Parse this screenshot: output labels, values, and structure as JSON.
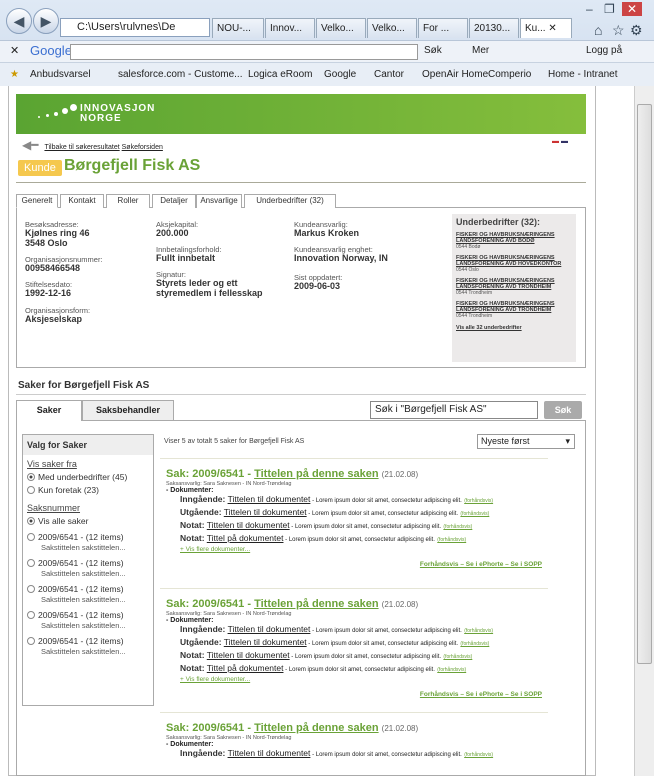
{
  "browser": {
    "url": "C:\\Users\\rulvnes\\De",
    "tabs": [
      "NOU-...",
      "Innov...",
      "Velko...",
      "Velko...",
      "For ...",
      "20130...",
      "Ku..."
    ],
    "google_label": "Google",
    "search_label": "Søk",
    "more_label": "Mer",
    "login_label": "Logg på",
    "favorites": [
      "Anbudsvarsel",
      "salesforce.com - Custome...",
      "Logica eRoom",
      "Google",
      "Cantor",
      "OpenAir Home",
      "Comperio",
      "Home - Intranet"
    ]
  },
  "site": {
    "brand_line1": "INNOVASJON",
    "brand_line2": "NORGE",
    "back_link": "Tilbake til søkeresultatet",
    "front_link": "Søkeforsiden"
  },
  "customer": {
    "badge": "Kunde",
    "name": "Børgefjell Fisk AS"
  },
  "tabs": [
    "Generelt",
    "Kontakt",
    "Roller",
    "Detaljer",
    "Ansvarlige",
    "Underbedrifter (32)"
  ],
  "info": {
    "col1": [
      {
        "label": "Besøksadresse:",
        "value": "Kjølnes ring 46\n3548 Oslo"
      },
      {
        "label": "Organisasjonsnummer:",
        "value": "00958466548"
      },
      {
        "label": "Stiftelsesdato:",
        "value": "1992-12-16"
      },
      {
        "label": "Organisasjonsform:",
        "value": "Aksjeselskap"
      }
    ],
    "col2": [
      {
        "label": "Aksjekapital:",
        "value": "200.000"
      },
      {
        "label": "Innbetalingsforhold:",
        "value": "Fullt innbetalt"
      },
      {
        "label": "Signatur:",
        "value": "Styrets leder og ett styremedlem i fellesskap"
      }
    ],
    "col3": [
      {
        "label": "Kundeansvarlig:",
        "value": "Markus Kroken"
      },
      {
        "label": "Kundeansvarlig enghet:",
        "value": "Innovation Norway, IN"
      },
      {
        "label": "Sist oppdatert:",
        "value": "2009-06-03"
      }
    ]
  },
  "subsidiaries": {
    "title": "Underbedrifter (32):",
    "items": [
      {
        "name": "FISKERI OG HAVBRUKSNÆRINGENS LANDSFORENING AVD BODØ",
        "place": "0544 Bodø"
      },
      {
        "name": "FISKERI OG HAVBRUKSNÆRINGENS LANDSFORENING AVD HOVEDKONTOR",
        "place": "0544 Oslo"
      },
      {
        "name": "FISKERI OG HAVBRUKSNÆRINGENS LANDSFORENING AVD TRONDHEIM",
        "place": "0544 Trondheim"
      },
      {
        "name": "FISKERI OG HAVBRUKSNÆRINGENS LANDSFORENING AVD TRONDHEIM",
        "place": "0544 Trondheim"
      }
    ],
    "all_link": "Vis alle 32 underbedrifter"
  },
  "cases": {
    "heading": "Saker for Børgefjell Fisk AS",
    "tab_saker": "Saker",
    "tab_saksbehandler": "Saksbehandler",
    "search_value": "Søk i \"Børgefjell Fisk AS\"",
    "search_btn": "Søk",
    "filter_title": "Valg for Saker",
    "show_from": "Vis saker fra",
    "opt_with": "Med underbedrifter (45)",
    "opt_only": "Kun foretak (23)",
    "casenr": "Saksnummer",
    "show_all": "Vis alle saker",
    "count_text": "Viser 5 av totalt 5 saker for Børgefjell Fisk AS",
    "sort": "Nyeste først",
    "filter_items": [
      {
        "nr": "2009/6541 - (12 items)",
        "sub": "Sakstittelen sakstittelen..."
      },
      {
        "nr": "2009/6541 - (12 items)",
        "sub": "Sakstittelen sakstittelen..."
      },
      {
        "nr": "2009/6541 - (12 items)",
        "sub": "Sakstittelen sakstittelen..."
      },
      {
        "nr": "2009/6541 - (12 items)",
        "sub": "Sakstittelen sakstittelen..."
      },
      {
        "nr": "2009/6541 - (12 items)",
        "sub": "Sakstittelen sakstittelen..."
      }
    ]
  },
  "case_items": [
    {
      "prefix": "Sak: 2009/6541 - ",
      "title": "Tittelen på denne saken",
      "date": "(21.02.08)",
      "meta": "Saksansvarlig: Sara Saknesen - IN Nord-Trøndelag",
      "docs_label": "- Dokumenter:",
      "docs": [
        {
          "type": "Inngående:",
          "title": "Tittelen til dokumentet"
        },
        {
          "type": "Utgående:",
          "title": "Tittelen til dokumentet"
        },
        {
          "type": "Notat:",
          "title": "Tittelen til dokumentet"
        },
        {
          "type": "Notat:",
          "title": "Tittel på dokumentet"
        }
      ],
      "lorem": " - Lorem ipsum dolor sit amet, consectetur adipiscing elit.",
      "preview": "(forhåndsvis)",
      "more": "+ Vis flere dokumenter...",
      "foot": "Forhåndsvis – Se i ePhorte – Se i SOPP"
    },
    {
      "prefix": "Sak: 2009/6541 - ",
      "title": "Tittelen på denne saken",
      "date": "(21.02.08)",
      "meta": "Saksansvarlig: Sara Saknesen - IN Nord-Trøndelag",
      "docs_label": "- Dokumenter:",
      "docs": [
        {
          "type": "Inngående:",
          "title": "Tittelen til dokumentet"
        },
        {
          "type": "Utgående:",
          "title": "Tittelen til dokumentet"
        },
        {
          "type": "Notat:",
          "title": "Tittelen til dokumentet"
        },
        {
          "type": "Notat:",
          "title": "Tittel på dokumentet"
        }
      ],
      "lorem": " - Lorem ipsum dolor sit amet, consectetur adipiscing elit.",
      "preview": "(forhåndsvis)",
      "more": "+ Vis flere dokumenter...",
      "foot": "Forhåndsvis – Se i ePhorte – Se i SOPP"
    },
    {
      "prefix": "Sak: 2009/6541 - ",
      "title": "Tittelen på denne saken",
      "date": "(21.02.08)",
      "meta": "Saksansvarlig: Sara Saknesen - IN Nord-Trøndelag",
      "docs_label": "- Dokumenter:",
      "docs": [
        {
          "type": "Inngående:",
          "title": "Tittelen til dokumentet"
        }
      ],
      "lorem": " - Lorem ipsum dolor sit amet, consectetur adipiscing elit.",
      "preview": "(forhåndsvis)",
      "more": "",
      "foot": ""
    }
  ]
}
